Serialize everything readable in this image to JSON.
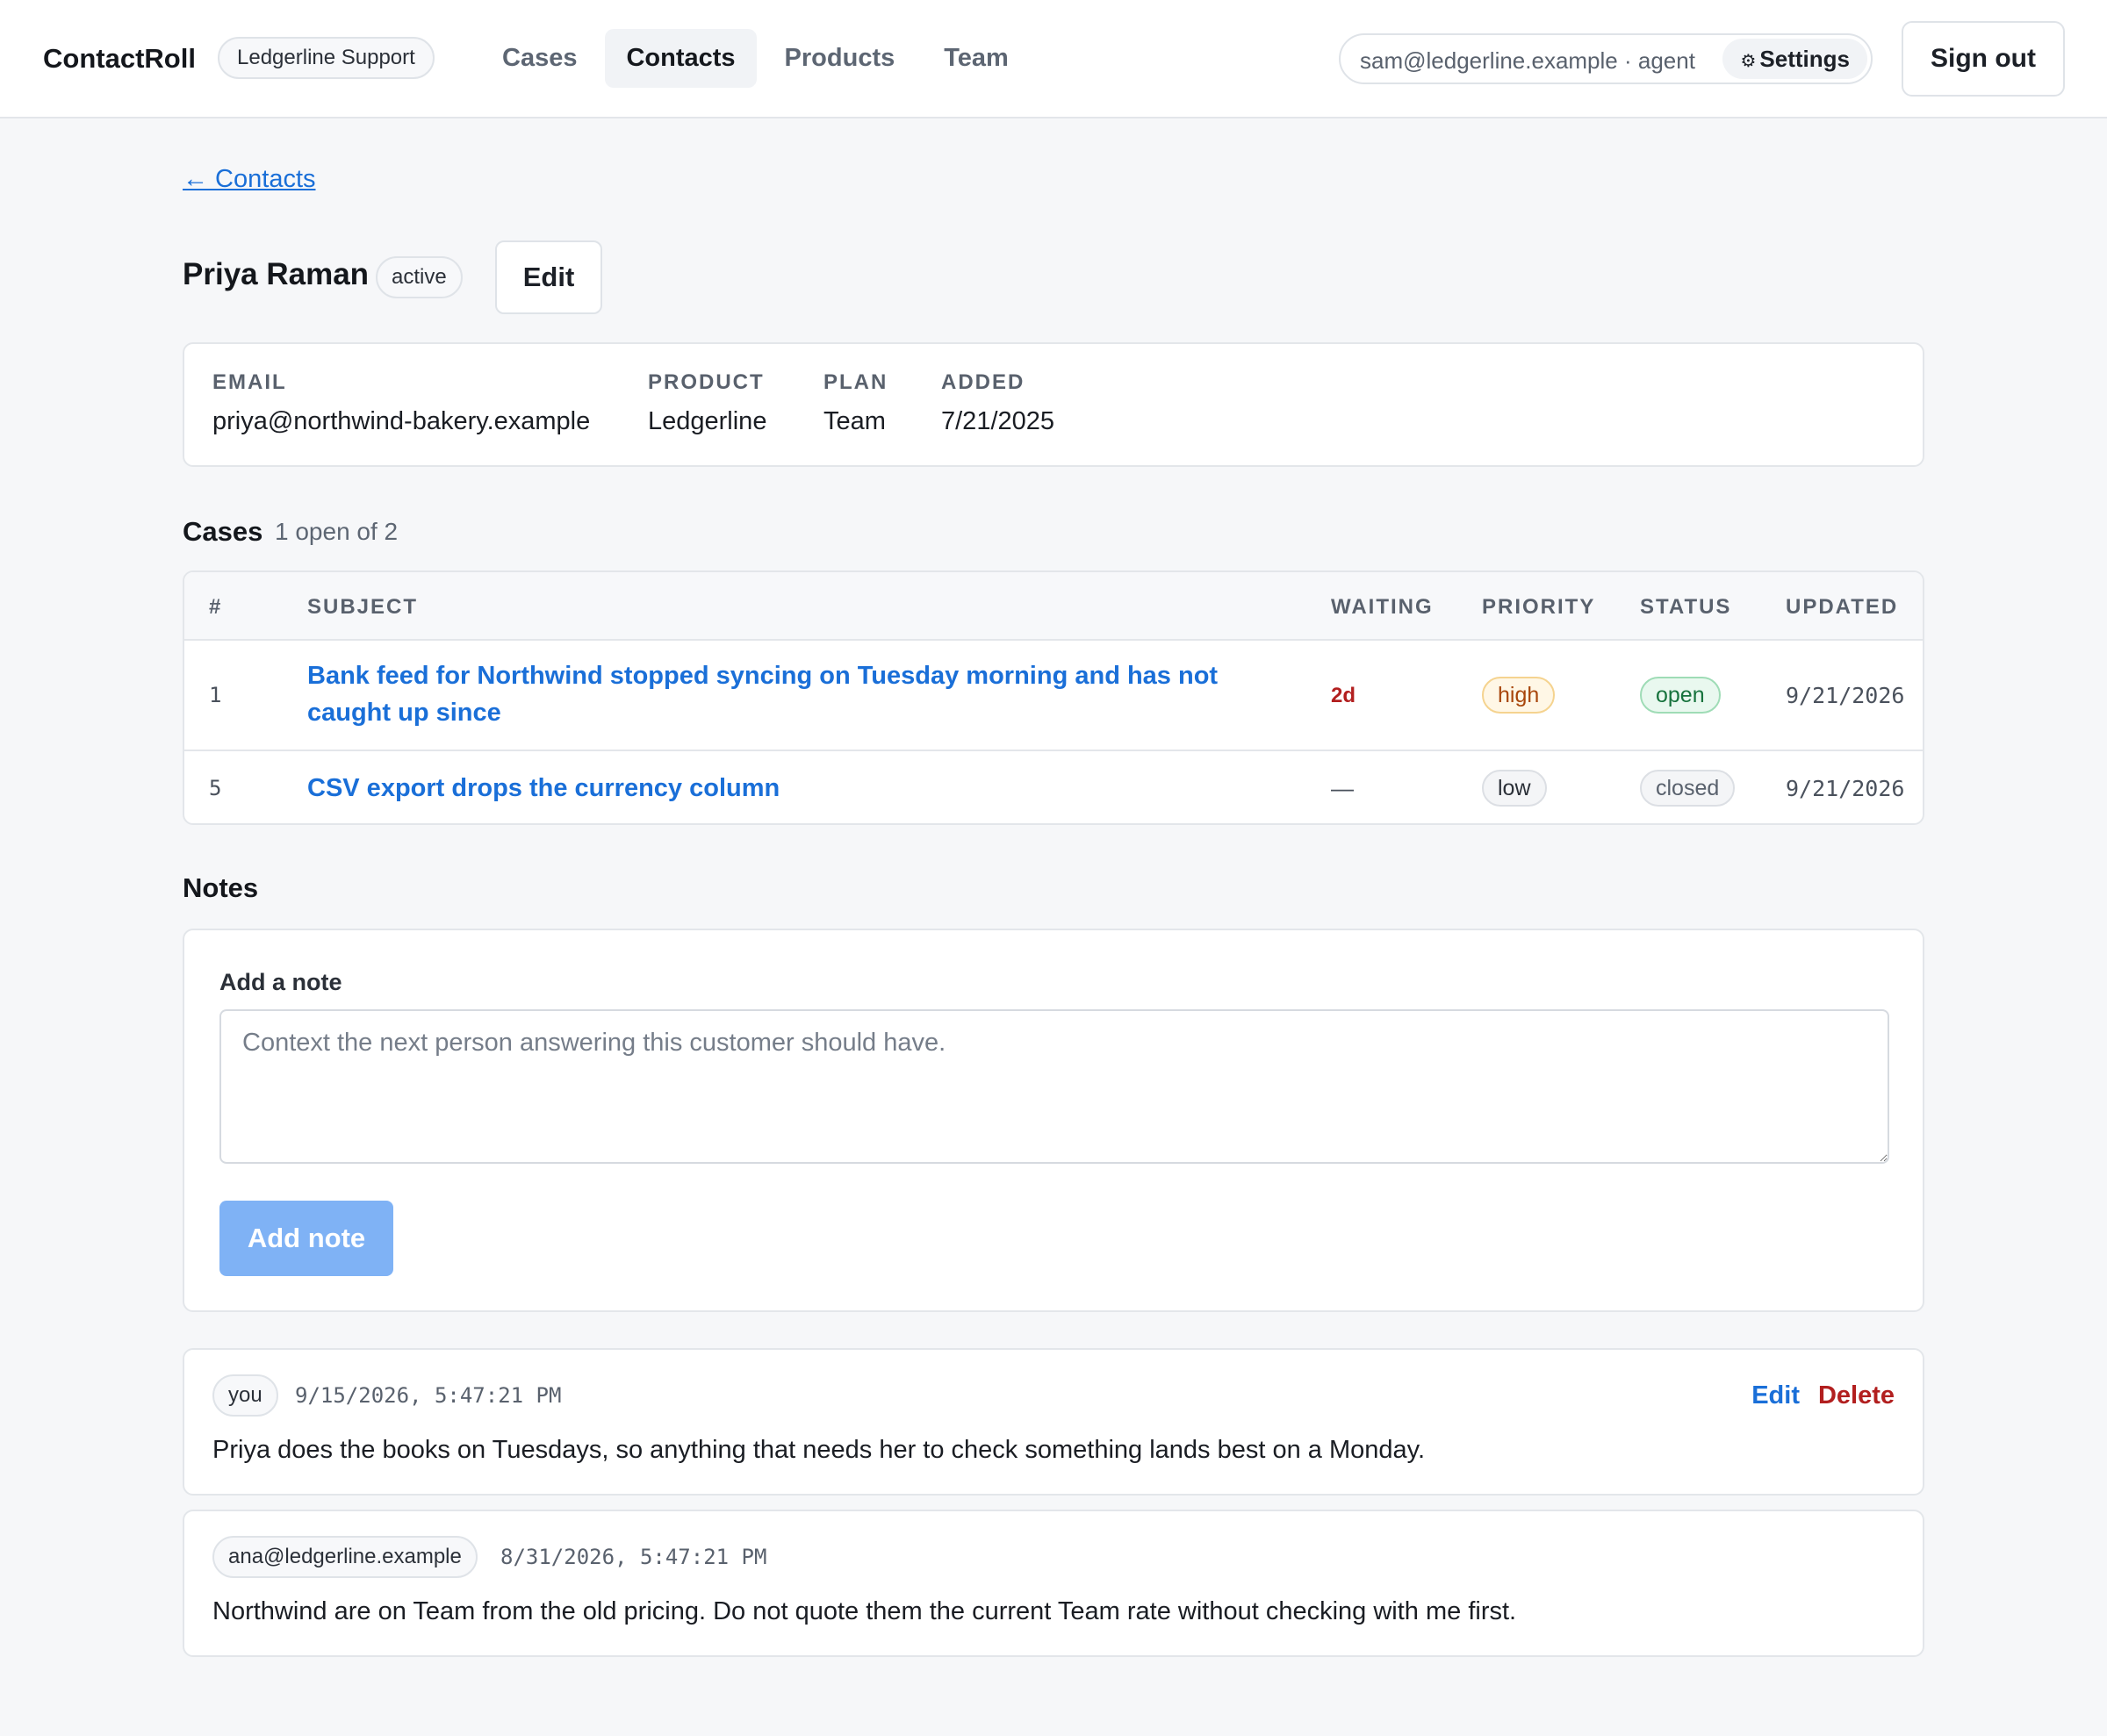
{
  "app": {
    "brand": "ContactRoll",
    "org": "Ledgerline Support",
    "nav": [
      "Cases",
      "Contacts",
      "Products",
      "Team"
    ],
    "active_nav": "Contacts",
    "user": "sam@ledgerline.example · agent",
    "settings_icon": "⚙",
    "settings_label": "Settings",
    "signout_label": "Sign out"
  },
  "contact": {
    "back_label": "← Contacts",
    "name": "Priya Raman",
    "status": "active",
    "edit_label": "Edit",
    "fields": {
      "email_label": "EMAIL",
      "email": "priya@northwind-bakery.example",
      "product_label": "PRODUCT",
      "product": "Ledgerline",
      "plan_label": "PLAN",
      "plan": "Team",
      "added_label": "ADDED",
      "added": "7/21/2025"
    }
  },
  "cases": {
    "title": "Cases",
    "summary": "1 open of 2",
    "headers": {
      "num": "#",
      "subject": "SUBJECT",
      "waiting": "WAITING",
      "priority": "PRIORITY",
      "status": "STATUS",
      "updated": "UPDATED"
    },
    "rows": [
      {
        "num": "1",
        "subject": "Bank feed for Northwind stopped syncing on Tuesday morning and has not caught up since",
        "waiting": "2d",
        "priority": "high",
        "status": "open",
        "updated": "9/21/2026"
      },
      {
        "num": "5",
        "subject": "CSV export drops the currency column",
        "waiting": "—",
        "priority": "low",
        "status": "closed",
        "updated": "9/21/2026"
      }
    ]
  },
  "notes": {
    "title": "Notes",
    "form_label": "Add a note",
    "placeholder": "Context the next person answering this customer should have.",
    "value": "",
    "submit_label": "Add note",
    "items": [
      {
        "author": "you",
        "time": "9/15/2026, 5:47:21 PM",
        "body": "Priya does the books on Tuesdays, so anything that needs her to check something lands best on a Monday.",
        "edit_label": "Edit",
        "delete_label": "Delete"
      },
      {
        "author": "ana@ledgerline.example",
        "time": "8/31/2026, 5:47:21 PM",
        "body": "Northwind are on Team from the old pricing. Do not quote them the current Team rate without checking with me first."
      }
    ]
  },
  "colors": {
    "accent": "#1a6fd8",
    "danger": "#b21f1f",
    "button_disabled": "#7fb2f5",
    "page_bg": "#f6f7f9"
  }
}
